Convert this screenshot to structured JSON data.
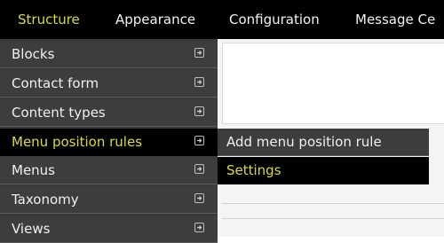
{
  "toolbar": {
    "items": [
      {
        "label": "Structure"
      },
      {
        "label": "Appearance"
      },
      {
        "label": "Configuration"
      },
      {
        "label": "Message Ce"
      }
    ]
  },
  "dropdown": {
    "items": [
      {
        "label": "Blocks"
      },
      {
        "label": "Contact form"
      },
      {
        "label": "Content types"
      },
      {
        "label": "Menu position rules"
      },
      {
        "label": "Menus"
      },
      {
        "label": "Taxonomy"
      },
      {
        "label": "Views"
      }
    ]
  },
  "submenu": {
    "items": [
      {
        "label": "Add menu position rule"
      },
      {
        "label": "Settings"
      }
    ]
  },
  "colors": {
    "toolbar_bg": "#000000",
    "menu_bg": "#3d3d3d",
    "active_text": "#d8dd32",
    "text": "#f0f0f0"
  }
}
